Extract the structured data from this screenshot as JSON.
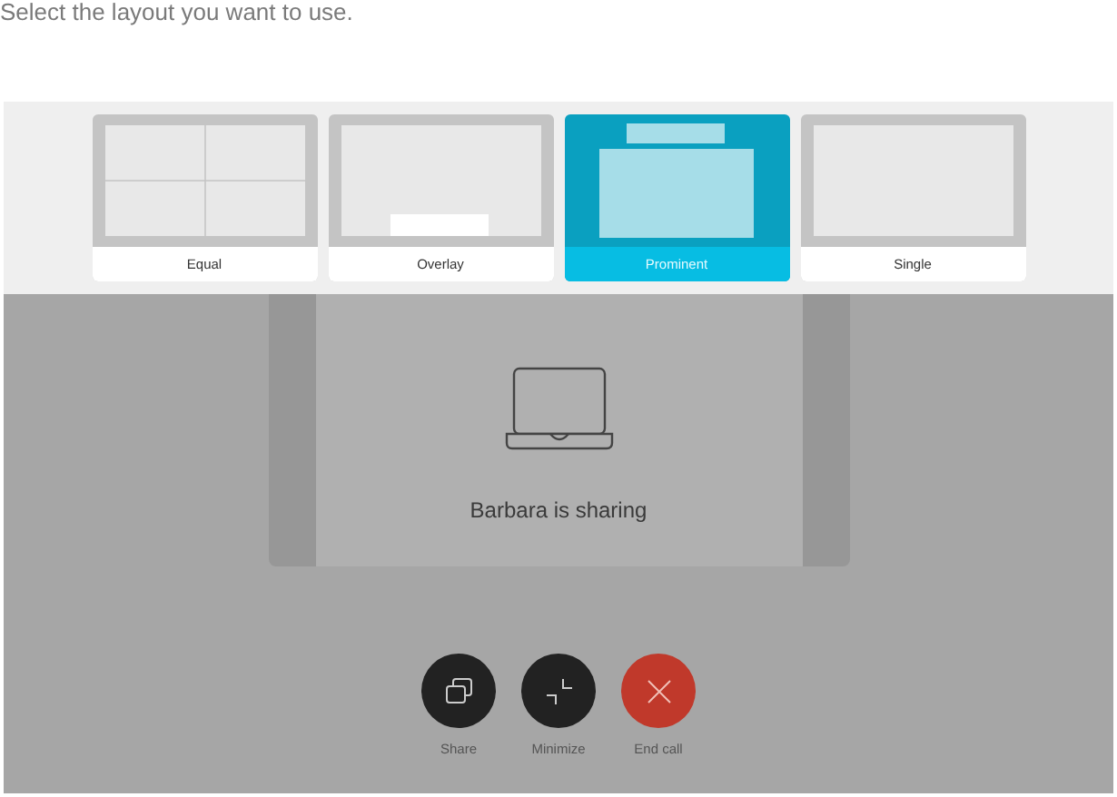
{
  "instruction": "Select the layout you want to use.",
  "layouts": [
    {
      "kind": "equal",
      "label": "Equal",
      "selected": false
    },
    {
      "kind": "overlay",
      "label": "Overlay",
      "selected": false
    },
    {
      "kind": "prominent",
      "label": "Prominent",
      "selected": true
    },
    {
      "kind": "single",
      "label": "Single",
      "selected": false
    }
  ],
  "sharing": {
    "message": "Barbara is sharing"
  },
  "controls": [
    {
      "kind": "share",
      "label": "Share"
    },
    {
      "kind": "minimize",
      "label": "Minimize"
    },
    {
      "kind": "end",
      "label": "End call"
    }
  ]
}
